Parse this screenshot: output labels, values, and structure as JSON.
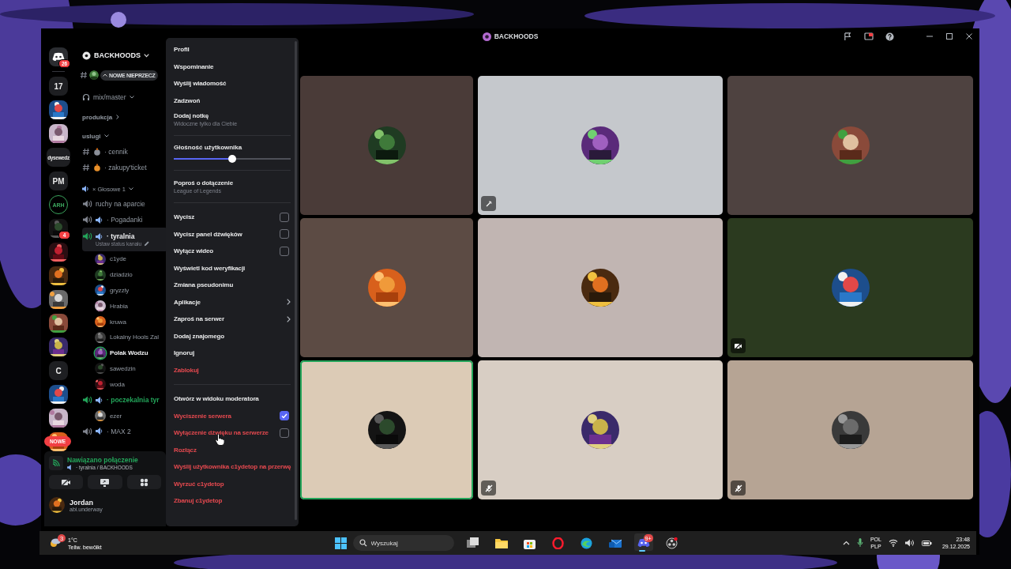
{
  "window": {
    "title": "BACKHOODS"
  },
  "servers": [
    {
      "kind": "logo",
      "badge": "26"
    },
    {
      "kind": "text",
      "label": "17"
    },
    {
      "kind": "picture"
    },
    {
      "kind": "picture"
    },
    {
      "kind": "text",
      "label": "dysewedz"
    },
    {
      "kind": "text",
      "label": "PM"
    },
    {
      "kind": "ring",
      "label": "ARH"
    },
    {
      "kind": "picture",
      "badge": "4"
    },
    {
      "kind": "picture"
    },
    {
      "kind": "picture"
    },
    {
      "kind": "picture"
    },
    {
      "kind": "picture"
    },
    {
      "kind": "picture"
    },
    {
      "kind": "text",
      "label": "C"
    },
    {
      "kind": "picture"
    },
    {
      "kind": "picture"
    },
    {
      "kind": "picture"
    }
  ],
  "new_pill": "NOWE",
  "server_header": {
    "name": "BACKHOODS"
  },
  "new_messages_pill": "NOWE NIEPRZECZ",
  "channels": [
    {
      "kind": "voice-link",
      "name": "mix/master"
    },
    {
      "kind": "category",
      "name": "produkcja",
      "expanded": false
    },
    {
      "kind": "category",
      "name": "uslugi",
      "expanded": true
    },
    {
      "kind": "text",
      "name": "· cennik"
    },
    {
      "kind": "text",
      "name": "· zakupy'ticket"
    },
    {
      "kind": "voice-category",
      "name": "× Głosowe 1"
    },
    {
      "kind": "voice",
      "name": "ruchy na aparcie",
      "active": false,
      "selected": false,
      "speaker": false
    },
    {
      "kind": "voice",
      "name": "· Pogadanki",
      "active": false,
      "selected": false,
      "speaker": true
    },
    {
      "kind": "voice",
      "name": "· tyralnia",
      "active": true,
      "selected": true,
      "speaker": true,
      "status": "Ustaw status kanału"
    },
    {
      "kind": "member",
      "name": "c1yde",
      "speaking": false
    },
    {
      "kind": "member",
      "name": "dziadzio",
      "speaking": false
    },
    {
      "kind": "member",
      "name": "gryzzly",
      "speaking": false
    },
    {
      "kind": "member",
      "name": "Hrabia",
      "speaking": false
    },
    {
      "kind": "member",
      "name": "kruwa",
      "speaking": false
    },
    {
      "kind": "member",
      "name": "Lokalny Hools Zal",
      "speaking": false
    },
    {
      "kind": "member",
      "name": "Polak Wodzu",
      "speaking": true
    },
    {
      "kind": "member",
      "name": "sawedzin",
      "speaking": false
    },
    {
      "kind": "member",
      "name": "woda",
      "speaking": false
    },
    {
      "kind": "voice",
      "name": "· poczekalnia tyr",
      "active": true,
      "selected": false,
      "speaker": true
    },
    {
      "kind": "member",
      "name": "ezer",
      "speaking": false
    },
    {
      "kind": "voice",
      "name": "· MAX 2",
      "active": false,
      "selected": false,
      "speaker": true
    }
  ],
  "voice_panel": {
    "status": "Nawiązano połączenie",
    "channel": "· tyralnia / BACKHOODS"
  },
  "user": {
    "name": "Jordan",
    "handle": "abi.underway"
  },
  "menu": [
    {
      "kind": "action",
      "label": "Profil",
      "danger": false
    },
    {
      "kind": "action",
      "label": "Wspominanie",
      "danger": false
    },
    {
      "kind": "action",
      "label": "Wyślij wiadomość",
      "danger": false
    },
    {
      "kind": "action",
      "label": "Zadzwoń",
      "danger": false
    },
    {
      "kind": "action",
      "label": "Dodaj notkę",
      "sub": "Widoczne tylko dla Ciebie",
      "danger": false
    },
    {
      "kind": "separator"
    },
    {
      "kind": "slider",
      "label": "Głośność użytkownika",
      "level": 0.5
    },
    {
      "kind": "separator"
    },
    {
      "kind": "action",
      "label": "Poproś o dołączenie",
      "sub": "League of Legends",
      "danger": false
    },
    {
      "kind": "separator"
    },
    {
      "kind": "checkbox",
      "label": "Wycisz",
      "checked": false,
      "danger": false
    },
    {
      "kind": "checkbox",
      "label": "Wycisz panel dźwięków",
      "checked": false,
      "danger": false
    },
    {
      "kind": "checkbox",
      "label": "Wyłącz wideo",
      "checked": false,
      "danger": false
    },
    {
      "kind": "action",
      "label": "Wyświetl kod weryfikacji",
      "danger": false
    },
    {
      "kind": "action",
      "label": "Zmiana pseudonimu",
      "danger": false
    },
    {
      "kind": "submenu",
      "label": "Aplikacje",
      "danger": false
    },
    {
      "kind": "submenu",
      "label": "Zaproś na serwer",
      "danger": false
    },
    {
      "kind": "action",
      "label": "Dodaj znajomego",
      "danger": false
    },
    {
      "kind": "action",
      "label": "Ignoruj",
      "danger": false
    },
    {
      "kind": "action",
      "label": "Zablokuj",
      "danger": true
    },
    {
      "kind": "separator"
    },
    {
      "kind": "action",
      "label": "Otwórz w widoku moderatora",
      "danger": false
    },
    {
      "kind": "checkbox",
      "label": "Wyciszenie serwera",
      "checked": true,
      "danger": true
    },
    {
      "kind": "checkbox",
      "label": "Wyłączenie dźwięku na serwerze",
      "checked": false,
      "danger": true
    },
    {
      "kind": "action",
      "label": "Rozłącz",
      "danger": true
    },
    {
      "kind": "action",
      "label": "Wyślij użytkownika c1ydetop na przerwę",
      "danger": true
    },
    {
      "kind": "action",
      "label": "Wyrzuć c1ydetop",
      "danger": true
    },
    {
      "kind": "action",
      "label": "Zbanuj c1ydetop",
      "danger": true
    }
  ],
  "tiles": [
    {
      "color": "#4a3b38",
      "speaking": false,
      "activity": false,
      "camera_off": false,
      "muted": false
    },
    {
      "color": "#c5c8cc",
      "speaking": false,
      "activity": true,
      "camera_off": false,
      "muted": false
    },
    {
      "color": "#4e4240",
      "speaking": false,
      "activity": false,
      "camera_off": false,
      "muted": false
    },
    {
      "color": "#5c4b44",
      "speaking": false,
      "activity": false,
      "camera_off": false,
      "muted": false
    },
    {
      "color": "#c1b5b2",
      "speaking": false,
      "activity": false,
      "camera_off": false,
      "muted": false
    },
    {
      "color": "#2b3a1f",
      "speaking": false,
      "activity": false,
      "camera_off": true,
      "muted": false
    },
    {
      "color": "#dccbb6",
      "speaking": true,
      "activity": false,
      "camera_off": false,
      "muted": false
    },
    {
      "color": "#d8cec4",
      "speaking": false,
      "activity": false,
      "camera_off": false,
      "muted": true
    },
    {
      "color": "#b6a494",
      "speaking": false,
      "activity": false,
      "camera_off": false,
      "muted": true
    }
  ],
  "taskbar": {
    "weather": {
      "temp": "1°C",
      "text": "Teilw. bewölkt",
      "badge": "3"
    },
    "search": {
      "placeholder": "Wyszukaj"
    },
    "apps": [
      {
        "kind": "task-view",
        "active": false
      },
      {
        "kind": "folder",
        "active": false
      },
      {
        "kind": "store",
        "active": false
      },
      {
        "kind": "opera",
        "active": false
      },
      {
        "kind": "edge",
        "active": false
      },
      {
        "kind": "mail",
        "active": false
      },
      {
        "kind": "chat",
        "active": true,
        "badge": "9+"
      },
      {
        "kind": "obs",
        "active": false
      }
    ],
    "lang": [
      "POL",
      "PLP"
    ],
    "time": "23:48",
    "date": "29.12.2025"
  }
}
